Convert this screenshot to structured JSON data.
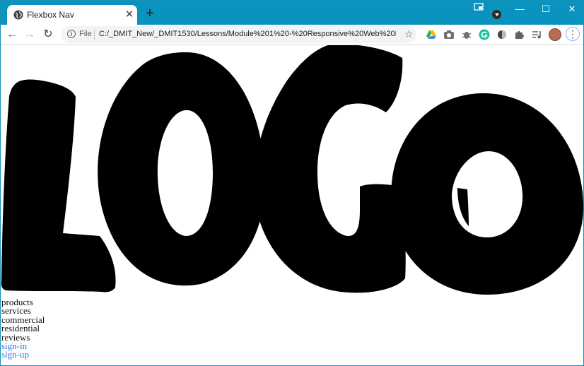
{
  "browser": {
    "tab_title": "Flexbox Nav",
    "new_tab_glyph": "+",
    "scheme_label": "File",
    "url": "C:/_DMIT_New/_DMIT1530/Lessons/Module%201%20-%20Responsive%20Web%20D...",
    "window_controls": [
      "—",
      "☐",
      "✕"
    ]
  },
  "icons": {
    "tab_favicon": "globe-icon",
    "back": "back-arrow-icon",
    "forward": "forward-arrow-icon",
    "reload": "reload-icon",
    "site_info": "info-icon",
    "bookmark": "star-icon",
    "extensions": [
      "google-drive-icon",
      "camera-icon",
      "bug-icon",
      "grammarly-icon",
      "dark-circle-icon",
      "puzzle-icon",
      "media-queue-icon"
    ],
    "menu": "kebab-menu-icon"
  },
  "colors": {
    "titlebar": "#0b93c0",
    "link": "#2b7cd3",
    "logo": "#000000"
  },
  "page": {
    "nav_items": [
      "products",
      "services",
      "commercial",
      "residential",
      "reviews"
    ],
    "auth_links": [
      "sign-in",
      "sign-up"
    ]
  }
}
